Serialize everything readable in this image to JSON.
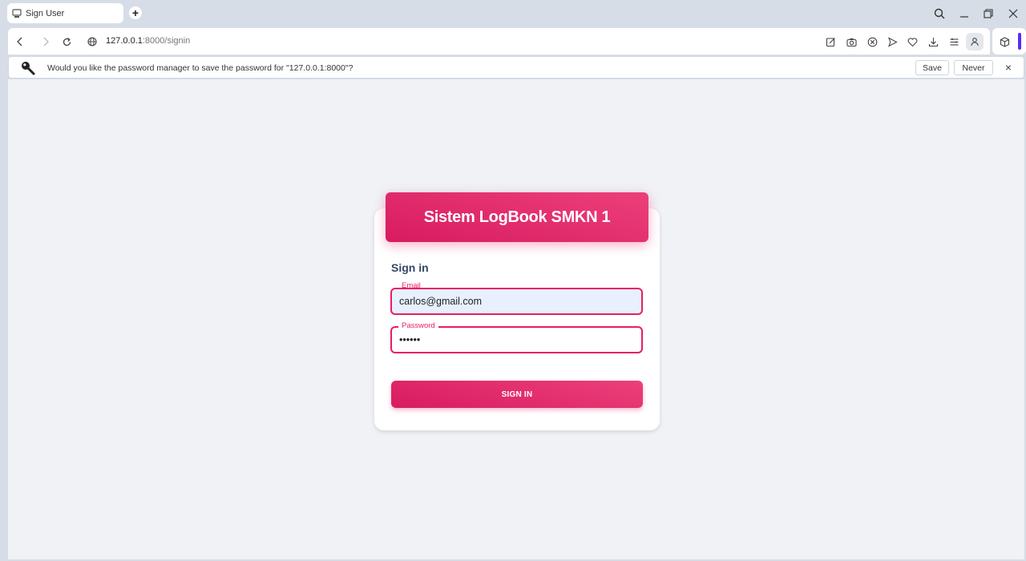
{
  "browser": {
    "tab": {
      "title": "Sign User",
      "favicon": "site-favicon-icon"
    },
    "new_tab_label": "+",
    "address": {
      "host": "127.0.0.1",
      "rest": ":8000/signin"
    }
  },
  "password_bar": {
    "message": "Would you like the password manager to save the password for \"127.0.0.1:8000\"?",
    "save_label": "Save",
    "never_label": "Never",
    "close_label": "×"
  },
  "login": {
    "header_title": "Sistem LogBook SMKN 1",
    "title": "Sign in",
    "email": {
      "label": "Email",
      "value": "carlos@gmail.com"
    },
    "password": {
      "label": "Password",
      "value": "123456"
    },
    "submit_label": "SIGN IN"
  },
  "colors": {
    "accent": "#e91e63",
    "heading": "#344767",
    "page_bg": "#f0f2f5"
  }
}
